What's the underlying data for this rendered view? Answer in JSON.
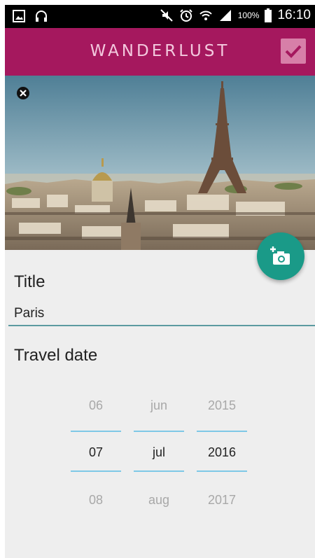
{
  "status_bar": {
    "battery": "100%",
    "time": "16:10"
  },
  "app_bar": {
    "title": "WANDERLUST",
    "accent_color": "#a5185e"
  },
  "form": {
    "title_label": "Title",
    "title_value": "Paris",
    "date_label": "Travel date"
  },
  "date_picker": {
    "day": {
      "prev": "06",
      "current": "07",
      "next": "08"
    },
    "month": {
      "prev": "jun",
      "current": "jul",
      "next": "aug"
    },
    "year": {
      "prev": "2015",
      "current": "2016",
      "next": "2017"
    }
  },
  "fab_color": "#1a9a88"
}
